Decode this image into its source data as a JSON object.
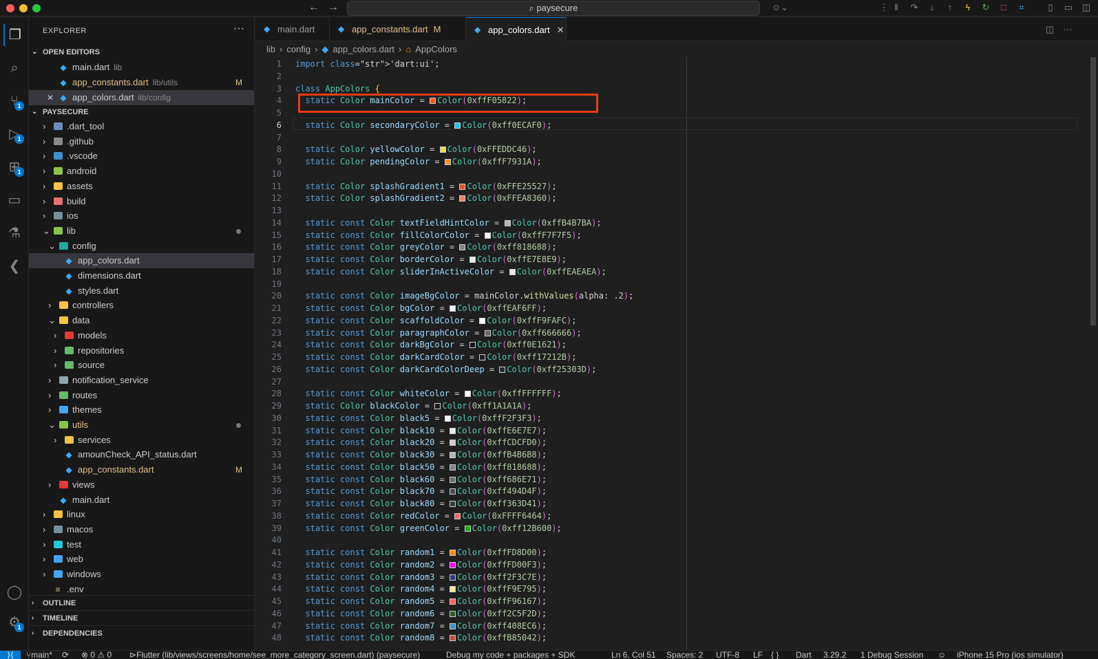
{
  "titlebar": {
    "search": "paysecure"
  },
  "activity": {
    "items": [
      {
        "name": "explorer-icon",
        "glyph": "❐",
        "badge": ""
      },
      {
        "name": "search-icon",
        "glyph": "⌕",
        "badge": ""
      },
      {
        "name": "source-control-icon",
        "glyph": "⑂",
        "badge": "1"
      },
      {
        "name": "run-debug-icon",
        "glyph": "▷",
        "badge": "1"
      },
      {
        "name": "extensions-icon",
        "glyph": "⊞",
        "badge": "1"
      },
      {
        "name": "remote-explorer-icon",
        "glyph": "▭",
        "badge": ""
      },
      {
        "name": "testing-icon",
        "glyph": "⚗",
        "badge": ""
      },
      {
        "name": "flutter-icon",
        "glyph": "❮",
        "badge": ""
      }
    ],
    "bottom": [
      {
        "name": "accounts-icon",
        "glyph": "◯",
        "badge": ""
      },
      {
        "name": "manage-gear-icon",
        "glyph": "⚙",
        "badge": "1"
      }
    ]
  },
  "sidebar": {
    "title": "EXPLORER",
    "open_editors_label": "OPEN EDITORS",
    "workspace_label": "PAYSECURE",
    "outline_label": "OUTLINE",
    "timeline_label": "TIMELINE",
    "dependencies_label": "DEPENDENCIES",
    "open_editors": [
      {
        "label": "main.dart",
        "sub": "lib",
        "mark": "",
        "close": ""
      },
      {
        "label": "app_constants.dart",
        "sub": "lib/utils",
        "mark": "M",
        "close": ""
      },
      {
        "label": "app_colors.dart",
        "sub": "lib/config",
        "mark": "",
        "close": "✕"
      }
    ],
    "tree": [
      {
        "label": ".dart_tool",
        "depth": 0,
        "chev": "›",
        "kind": "folder",
        "color": "#6c8ebf"
      },
      {
        "label": ".github",
        "depth": 0,
        "chev": "›",
        "kind": "folder",
        "color": "#8a8a8a"
      },
      {
        "label": ".vscode",
        "depth": 0,
        "chev": "›",
        "kind": "folder",
        "color": "#3d8fd1"
      },
      {
        "label": "android",
        "depth": 0,
        "chev": "›",
        "kind": "folder",
        "color": "#8bc34a"
      },
      {
        "label": "assets",
        "depth": 0,
        "chev": "›",
        "kind": "folder",
        "color": "#f4c542"
      },
      {
        "label": "build",
        "depth": 0,
        "chev": "›",
        "kind": "folder",
        "color": "#e57373"
      },
      {
        "label": "ios",
        "depth": 0,
        "chev": "›",
        "kind": "folder",
        "color": "#78909c"
      },
      {
        "label": "lib",
        "depth": 0,
        "chev": "⌄",
        "kind": "folder",
        "color": "#8bc34a",
        "dot": true
      },
      {
        "label": "config",
        "depth": 1,
        "chev": "⌄",
        "kind": "folder",
        "color": "#26a69a"
      },
      {
        "label": "app_colors.dart",
        "depth": 2,
        "chev": "",
        "kind": "file",
        "selected": true
      },
      {
        "label": "dimensions.dart",
        "depth": 2,
        "chev": "",
        "kind": "file"
      },
      {
        "label": "styles.dart",
        "depth": 2,
        "chev": "",
        "kind": "file"
      },
      {
        "label": "controllers",
        "depth": 1,
        "chev": "›",
        "kind": "folder",
        "color": "#f4c542"
      },
      {
        "label": "data",
        "depth": 1,
        "chev": "⌄",
        "kind": "folder",
        "color": "#f4c542"
      },
      {
        "label": "models",
        "depth": 2,
        "chev": "›",
        "kind": "folder",
        "color": "#e53935"
      },
      {
        "label": "repositories",
        "depth": 2,
        "chev": "›",
        "kind": "folder",
        "color": "#66bb6a"
      },
      {
        "label": "source",
        "depth": 2,
        "chev": "›",
        "kind": "folder",
        "color": "#66bb6a"
      },
      {
        "label": "notification_service",
        "depth": 1,
        "chev": "›",
        "kind": "folder",
        "color": "#90a4ae"
      },
      {
        "label": "routes",
        "depth": 1,
        "chev": "›",
        "kind": "folder",
        "color": "#66bb6a"
      },
      {
        "label": "themes",
        "depth": 1,
        "chev": "›",
        "kind": "folder",
        "color": "#42a5f5"
      },
      {
        "label": "utils",
        "depth": 1,
        "chev": "⌄",
        "kind": "folder",
        "color": "#8bc34a",
        "modified": true,
        "dot": true
      },
      {
        "label": "services",
        "depth": 2,
        "chev": "›",
        "kind": "folder",
        "color": "#f4c542"
      },
      {
        "label": "amounCheck_API_status.dart",
        "depth": 2,
        "chev": "",
        "kind": "file"
      },
      {
        "label": "app_constants.dart",
        "depth": 2,
        "chev": "",
        "kind": "file",
        "modified": true,
        "mark": "M"
      },
      {
        "label": "views",
        "depth": 1,
        "chev": "›",
        "kind": "folder",
        "color": "#e53935"
      },
      {
        "label": "main.dart",
        "depth": 1,
        "chev": "",
        "kind": "file"
      },
      {
        "label": "linux",
        "depth": 0,
        "chev": "›",
        "kind": "folder",
        "color": "#f4c542"
      },
      {
        "label": "macos",
        "depth": 0,
        "chev": "›",
        "kind": "folder",
        "color": "#78909c"
      },
      {
        "label": "test",
        "depth": 0,
        "chev": "›",
        "kind": "folder",
        "color": "#26c6da"
      },
      {
        "label": "web",
        "depth": 0,
        "chev": "›",
        "kind": "folder",
        "color": "#42a5f5"
      },
      {
        "label": "windows",
        "depth": 0,
        "chev": "›",
        "kind": "folder",
        "color": "#42a5f5"
      },
      {
        "label": ".env",
        "depth": 0,
        "chev": "",
        "kind": "env"
      }
    ]
  },
  "tabs": [
    {
      "label": "main.dart",
      "mark": "",
      "close": "",
      "active": false
    },
    {
      "label": "app_constants.dart",
      "mark": "M",
      "close": "",
      "active": false
    },
    {
      "label": "app_colors.dart",
      "mark": "",
      "close": "✕",
      "active": true
    }
  ],
  "breadcrumb": {
    "parts": [
      "lib",
      "config",
      "app_colors.dart",
      "AppColors"
    ],
    "sep": "›"
  },
  "editor": {
    "current_line": 6,
    "lines": [
      {
        "n": "1",
        "t": "import 'dart:ui';"
      },
      {
        "n": "2",
        "t": ""
      },
      {
        "n": "3",
        "t": "class AppColors {"
      },
      {
        "n": "4",
        "t": "  static Color mainColor = Color(0xffF05822);",
        "sw": "#F05822"
      },
      {
        "n": "5",
        "t": ""
      },
      {
        "n": "6",
        "t": "  static Color secondaryColor = Color(0xff0ECAF0);",
        "sw": "#0ECAF0"
      },
      {
        "n": "7",
        "t": ""
      },
      {
        "n": "8",
        "t": "  static Color yellowColor = Color(0xFFEDDC46);",
        "sw": "#EDDC46"
      },
      {
        "n": "9",
        "t": "  static Color pendingColor = Color(0xffF7931A);",
        "sw": "#F7931A"
      },
      {
        "n": "10",
        "t": ""
      },
      {
        "n": "11",
        "t": "  static Color splashGradient1 = Color(0xFFE25527);",
        "sw": "#E25527"
      },
      {
        "n": "12",
        "t": "  static Color splashGradient2 = Color(0xFFEA8360);",
        "sw": "#EA8360"
      },
      {
        "n": "13",
        "t": ""
      },
      {
        "n": "14",
        "t": "  static const Color textFieldHintColor = Color(0xffB4B7BA);",
        "sw": "#B4B7BA"
      },
      {
        "n": "15",
        "t": "  static const Color fillColorColor = Color(0xffF7F7F5);",
        "sw": "#F7F7F5"
      },
      {
        "n": "16",
        "t": "  static const Color greyColor = Color(0xff818688);",
        "sw": "#818688"
      },
      {
        "n": "17",
        "t": "  static const Color borderColor = Color(0xffE7E8E9);",
        "sw": "#E7E8E9"
      },
      {
        "n": "18",
        "t": "  static const Color sliderInActiveColor = Color(0xffEAEAEA);",
        "sw": "#EAEAEA"
      },
      {
        "n": "19",
        "t": ""
      },
      {
        "n": "20",
        "t": "  static const Color imageBgColor = mainColor.withValues(alpha: .2);"
      },
      {
        "n": "21",
        "t": "  static const Color bgColor = Color(0xffEAF6FF);",
        "sw": "#EAF6FF"
      },
      {
        "n": "22",
        "t": "  static const Color scaffoldColor = Color(0xffF9FAFC);",
        "sw": "#F9FAFC"
      },
      {
        "n": "23",
        "t": "  static const Color paragraphColor = Color(0xff666666);",
        "sw": "#666666"
      },
      {
        "n": "24",
        "t": "  static const Color darkBgColor = Color(0xff0E1621);",
        "sw": "#0E1621"
      },
      {
        "n": "25",
        "t": "  static const Color darkCardColor = Color(0xff17212B);",
        "sw": "#17212B"
      },
      {
        "n": "26",
        "t": "  static const Color darkCardColorDeep = Color(0xff25303D);",
        "sw": "#25303D"
      },
      {
        "n": "27",
        "t": ""
      },
      {
        "n": "28",
        "t": "  static const Color whiteColor = Color(0xffFFFFFF);",
        "sw": "#FFFFFF"
      },
      {
        "n": "29",
        "t": "  static Color blackColor = Color(0xff1A1A1A);",
        "sw": "#1A1A1A"
      },
      {
        "n": "30",
        "t": "  static const Color black5 = Color(0xffF2F3F3);",
        "sw": "#F2F3F3"
      },
      {
        "n": "31",
        "t": "  static const Color black10 = Color(0xffE6E7E7);",
        "sw": "#E6E7E7"
      },
      {
        "n": "32",
        "t": "  static const Color black20 = Color(0xffCDCFD0);",
        "sw": "#CDCFD0"
      },
      {
        "n": "33",
        "t": "  static const Color black30 = Color(0xffB4B6B8);",
        "sw": "#B4B6B8"
      },
      {
        "n": "34",
        "t": "  static const Color black50 = Color(0xff818688);",
        "sw": "#818688"
      },
      {
        "n": "35",
        "t": "  static const Color black60 = Color(0xff686E71);",
        "sw": "#686E71"
      },
      {
        "n": "36",
        "t": "  static const Color black70 = Color(0xff494D4F);",
        "sw": "#494D4F"
      },
      {
        "n": "37",
        "t": "  static const Color black80 = Color(0xff363D41);",
        "sw": "#363D41"
      },
      {
        "n": "38",
        "t": "  static const Color redColor = Color(0xFFFF6464);",
        "sw": "#FF6464"
      },
      {
        "n": "39",
        "t": "  static const Color greenColor = Color(0xff12B600);",
        "sw": "#12B600"
      },
      {
        "n": "40",
        "t": ""
      },
      {
        "n": "41",
        "t": "  static const Color random1 = Color(0xffFD8D00);",
        "sw": "#FD8D00"
      },
      {
        "n": "42",
        "t": "  static const Color random2 = Color(0xffFD00F3);",
        "sw": "#FD00F3"
      },
      {
        "n": "43",
        "t": "  static const Color random3 = Color(0xff2F3C7E);",
        "sw": "#2F3C7E"
      },
      {
        "n": "44",
        "t": "  static const Color random4 = Color(0xffF9E795);",
        "sw": "#F9E795"
      },
      {
        "n": "45",
        "t": "  static const Color random5 = Color(0xffF96167);",
        "sw": "#F96167"
      },
      {
        "n": "46",
        "t": "  static const Color random6 = Color(0xff2C5F2D);",
        "sw": "#2C5F2D"
      },
      {
        "n": "47",
        "t": "  static const Color random7 = Color(0xff408EC6);",
        "sw": "#408EC6"
      },
      {
        "n": "48",
        "t": "  static const Color random8 = Color(0xffB85042);",
        "sw": "#B85042"
      }
    ]
  },
  "status": {
    "branch": "main*",
    "sync": "⟳",
    "problems": "⊗ 0 ⚠ 0",
    "flutter": "Flutter (lib/views/screens/home/see_more_category_screen.dart) (paysecure)",
    "debug_mode": "Debug my code + packages + SDK",
    "position": "Ln 6, Col 51",
    "spaces": "Spaces: 2",
    "encoding": "UTF-8",
    "eol": "LF",
    "braces": "{ }",
    "language": "Dart",
    "version": "3.29.2",
    "debug_session": "1 Debug Session",
    "device": "iPhone 15 Pro (ios simulator)"
  },
  "colors": {
    "accent": "#0078d4",
    "highlight_box": "#ea3c12",
    "modified": "#e2c08d"
  }
}
